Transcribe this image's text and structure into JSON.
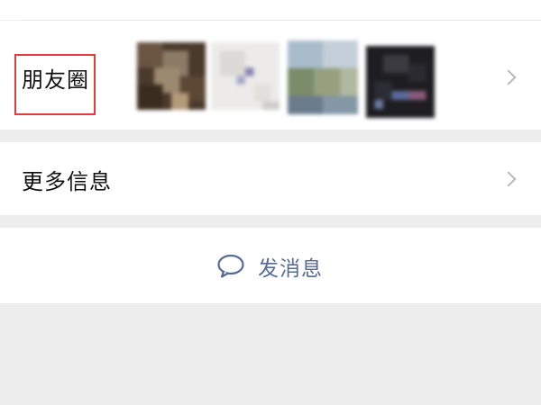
{
  "profile": {
    "moments": {
      "label": "朋友圈",
      "thumbnail_count": 4
    },
    "more_info": {
      "label": "更多信息"
    },
    "send_message": {
      "label": "发消息",
      "icon": "chat-bubble-icon"
    }
  },
  "colors": {
    "background": "#ededed",
    "card": "#ffffff",
    "link_blue": "#576b95",
    "highlight_red": "#e23c3c",
    "chevron": "#b8b8b8"
  }
}
